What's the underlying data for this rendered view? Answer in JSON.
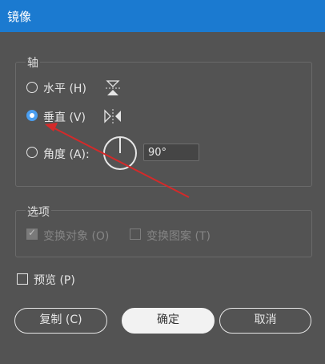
{
  "window": {
    "title": "镜像"
  },
  "axis_group": {
    "title": "轴",
    "horizontal_label": "水平 (H)",
    "vertical_label": "垂直 (V)",
    "angle_label": "角度 (A):",
    "angle_value": "90°",
    "selected": "vertical"
  },
  "options_group": {
    "title": "选项",
    "transform_objects_label": "变换对象 (O)",
    "transform_patterns_label": "变换图案 (T)"
  },
  "preview_label": "预览 (P)",
  "buttons": {
    "copy": "复制 (C)",
    "ok": "确定",
    "cancel": "取消"
  },
  "colors": {
    "titlebar": "#1b7ad0",
    "background": "#535353",
    "annotation_arrow": "#d42a2a"
  }
}
